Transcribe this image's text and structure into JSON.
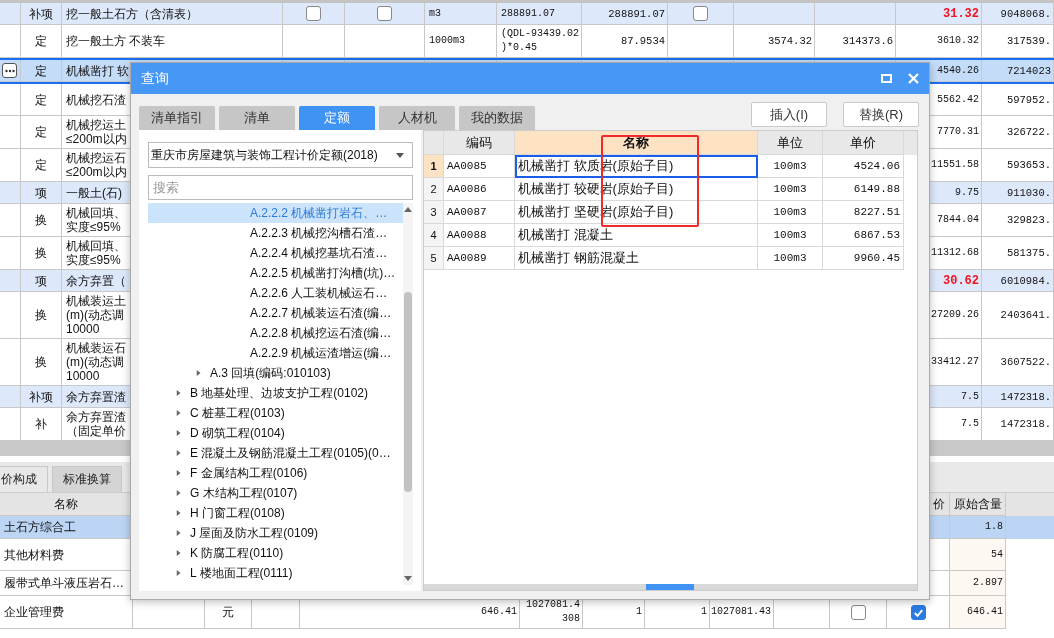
{
  "top_table": {
    "rows": [
      {
        "kind": "group",
        "selected": false,
        "type": "补项",
        "name": "挖一般土石方（含清表）",
        "flags": [
          {
            "checked": false
          },
          {
            "checked": false
          },
          {
            "checked": false
          }
        ],
        "unit": "m3",
        "column_6": "288891.07",
        "column_7": "288891.07",
        "column_11": "31.32",
        "alert": true,
        "column_12": "9048068."
      },
      {
        "kind": "item",
        "selected": false,
        "type": "定",
        "name": "挖一般土方 不装车",
        "unit": "1000m3",
        "column_6": "(QDL-93439.02\n)*0.45",
        "column_7": "87.9534",
        "column_9": "3574.32",
        "column_10": "314373.6",
        "column_11": "3610.32",
        "alert": false,
        "column_12": "317539."
      },
      {
        "kind": "item",
        "selected": true,
        "type": "定",
        "name": "机械凿打 软",
        "column_11": "4540.26",
        "alert": false,
        "column_12": "7214023"
      },
      {
        "kind": "item",
        "selected": false,
        "type": "定",
        "name": "机械挖石渣",
        "column_11": "5562.42",
        "alert": false,
        "column_12": "597952."
      },
      {
        "kind": "item",
        "selected": false,
        "type": "定",
        "name": "机械挖运土\n≤200m以内",
        "column_11": "7770.31",
        "alert": false,
        "column_12": "326722."
      },
      {
        "kind": "item",
        "selected": false,
        "type": "定",
        "name": "机械挖运石\n≤200m以内",
        "column_11": "11551.58",
        "alert": false,
        "column_12": "593653."
      },
      {
        "kind": "group",
        "selected": false,
        "type": "项",
        "name": "一般土(石)",
        "column_11": "9.75",
        "alert": false,
        "column_12": "911030."
      },
      {
        "kind": "item",
        "selected": false,
        "type": "换",
        "name": "机械回填、实度≤95%",
        "column_11": "7844.04",
        "alert": false,
        "column_12": "329823."
      },
      {
        "kind": "item",
        "selected": false,
        "type": "换",
        "name": "机械回填、实度≤95%",
        "column_11": "11312.68",
        "alert": false,
        "column_12": "581375."
      },
      {
        "kind": "group",
        "selected": false,
        "type": "项",
        "name": "余方弃置（",
        "column_11": "30.62",
        "alert": true,
        "column_12": "6010984."
      },
      {
        "kind": "item",
        "selected": false,
        "type": "换",
        "name": "机械装运土\n(m)(动态调\n10000",
        "column_11": "27209.26",
        "alert": false,
        "column_12": "2403641."
      },
      {
        "kind": "item",
        "selected": false,
        "type": "换",
        "name": "机械装运石\n(m)(动态调\n10000",
        "column_11": "33412.27",
        "alert": false,
        "column_12": "3607522."
      },
      {
        "kind": "group",
        "selected": false,
        "type": "补项",
        "name": "余方弃置渣",
        "column_11": "7.5",
        "alert": false,
        "column_12": "1472318."
      },
      {
        "kind": "item",
        "selected": false,
        "type": "补",
        "name": "余方弃置渣（固定单价",
        "column_11": "7.5",
        "alert": false,
        "column_12": "1472318."
      }
    ]
  },
  "bottom_panel": {
    "tabs": [
      {
        "label": "价构成",
        "selected": true
      },
      {
        "label": "标准换算",
        "selected": false
      }
    ],
    "header": {
      "name": "名称",
      "column_12": "价",
      "original_amount": "原始含量"
    },
    "rows": [
      {
        "name": "土石方综合工",
        "selected": true,
        "original_amount": "1.8"
      },
      {
        "name": "其他材料费",
        "selected": false,
        "original_amount": "54"
      },
      {
        "name": "履带式单斗液压岩石…",
        "selected": false,
        "original_amount": "2.897"
      },
      {
        "name": "企业管理费",
        "selected": false,
        "unit": "元",
        "column_6": "646.41",
        "column_7": "1027081.4\n308",
        "column_8": "1",
        "column_9": "1",
        "column_10": "1027081.43",
        "flags": [
          {
            "checked": false
          },
          {
            "checked": true
          }
        ],
        "original_amount": "646.41"
      }
    ]
  },
  "dialog": {
    "title": "查询",
    "tabs": [
      {
        "label": "清单指引",
        "selected": false
      },
      {
        "label": "清单",
        "selected": false
      },
      {
        "label": "定额",
        "selected": true
      },
      {
        "label": "人材机",
        "selected": false
      },
      {
        "label": "我的数据",
        "selected": false
      }
    ],
    "buttons": [
      "插入(I)",
      "替换(R)"
    ],
    "library": "重庆市房屋建筑与装饰工程计价定额(2018)",
    "search": {
      "placeholder": "搜索"
    },
    "tree": [
      {
        "children": [
          {
            "children": [
              {
                "children": [
                  {
                    "label": "A.2.2.2 机械凿打岩石、…",
                    "selected": true
                  },
                  {
                    "label": "A.2.2.3 机械挖沟槽石渣…",
                    "selected": false
                  },
                  {
                    "label": "A.2.2.4 机械挖基坑石渣…",
                    "selected": false
                  },
                  {
                    "label": "A.2.2.5 机械凿打沟槽(坑)…",
                    "selected": false
                  },
                  {
                    "label": "A.2.2.6 人工装机械运石…",
                    "selected": false
                  },
                  {
                    "label": "A.2.2.7 机械装运石渣(编…",
                    "selected": false
                  },
                  {
                    "label": "A.2.2.8 机械挖运石渣(编…",
                    "selected": false
                  },
                  {
                    "label": "A.2.2.9 机械运渣增运(编…",
                    "selected": false
                  }
                ]
              }
            ]
          },
          {
            "label": "A.3 回填(编码:010103)",
            "expanded": false,
            "selected": false
          }
        ]
      },
      {
        "label": "B 地基处理、边坡支护工程(0102)",
        "expanded": false,
        "selected": false
      },
      {
        "label": "C 桩基工程(0103)",
        "expanded": false,
        "selected": false
      },
      {
        "label": "D 砌筑工程(0104)",
        "expanded": false,
        "selected": false
      },
      {
        "label": "E 混凝土及钢筋混凝土工程(0105)(0…",
        "expanded": false,
        "selected": false
      },
      {
        "label": "F 金属结构工程(0106)",
        "expanded": false,
        "selected": false
      },
      {
        "label": "G 木结构工程(0107)",
        "expanded": false,
        "selected": false
      },
      {
        "label": "H 门窗工程(0108)",
        "expanded": false,
        "selected": false
      },
      {
        "label": "J 屋面及防水工程(0109)",
        "expanded": false,
        "selected": false
      },
      {
        "label": "K 防腐工程(0110)",
        "expanded": false,
        "selected": false
      },
      {
        "label": "L 楼地面工程(0111)",
        "expanded": false,
        "selected": false
      }
    ],
    "grid": {
      "columns": [
        {
          "label": "编码",
          "selected": false
        },
        {
          "label": "名称",
          "selected": true
        },
        {
          "label": "单位",
          "selected": false
        },
        {
          "label": "单价",
          "selected": false
        }
      ],
      "rows": [
        {
          "number": "1",
          "code": "AA0085",
          "name": "机械凿打 软质岩(原始子目)",
          "unit": "100m3",
          "price": "4524.06",
          "selected": true
        },
        {
          "number": "2",
          "code": "AA0086",
          "name": "机械凿打 较硬岩(原始子目)",
          "unit": "100m3",
          "price": "6149.88",
          "selected": false
        },
        {
          "number": "3",
          "code": "AA0087",
          "name": "机械凿打 坚硬岩(原始子目)",
          "unit": "100m3",
          "price": "8227.51",
          "selected": false
        },
        {
          "number": "4",
          "code": "AA0088",
          "name": "机械凿打 混凝土",
          "unit": "100m3",
          "price": "6867.53",
          "selected": false
        },
        {
          "number": "5",
          "code": "AA0089",
          "name": "机械凿打 钢筋混凝土",
          "unit": "100m3",
          "price": "9960.45",
          "selected": false
        }
      ]
    }
  }
}
